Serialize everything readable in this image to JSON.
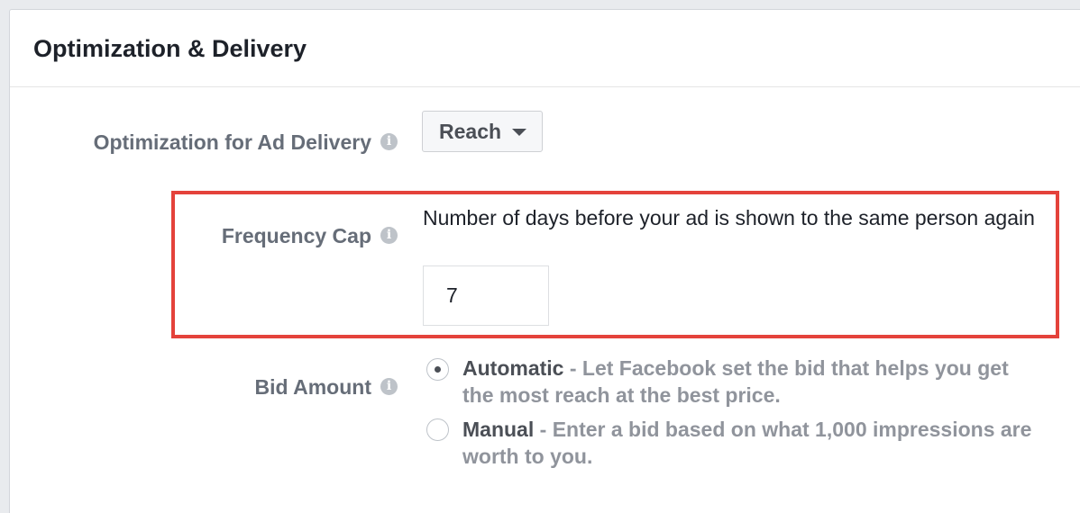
{
  "header": {
    "title": "Optimization & Delivery"
  },
  "optimization": {
    "label": "Optimization for Ad Delivery",
    "info_icon": "i",
    "dropdown_value": "Reach",
    "dropdown_icon": "caret-down"
  },
  "frequency_cap": {
    "label": "Frequency Cap",
    "info_icon": "i",
    "description": "Number of days before your ad is shown to the same person again",
    "value": "7",
    "highlight_color": "#e4423b"
  },
  "bid_amount": {
    "label": "Bid Amount",
    "info_icon": "i",
    "options": [
      {
        "title": "Automatic",
        "separator": " - ",
        "description": "Let Facebook set the bid that helps you get the most reach at the best price.",
        "selected": true
      },
      {
        "title": "Manual",
        "separator": " - ",
        "description": "Enter a bid based on what 1,000 impressions are worth to you.",
        "selected": false
      }
    ]
  }
}
